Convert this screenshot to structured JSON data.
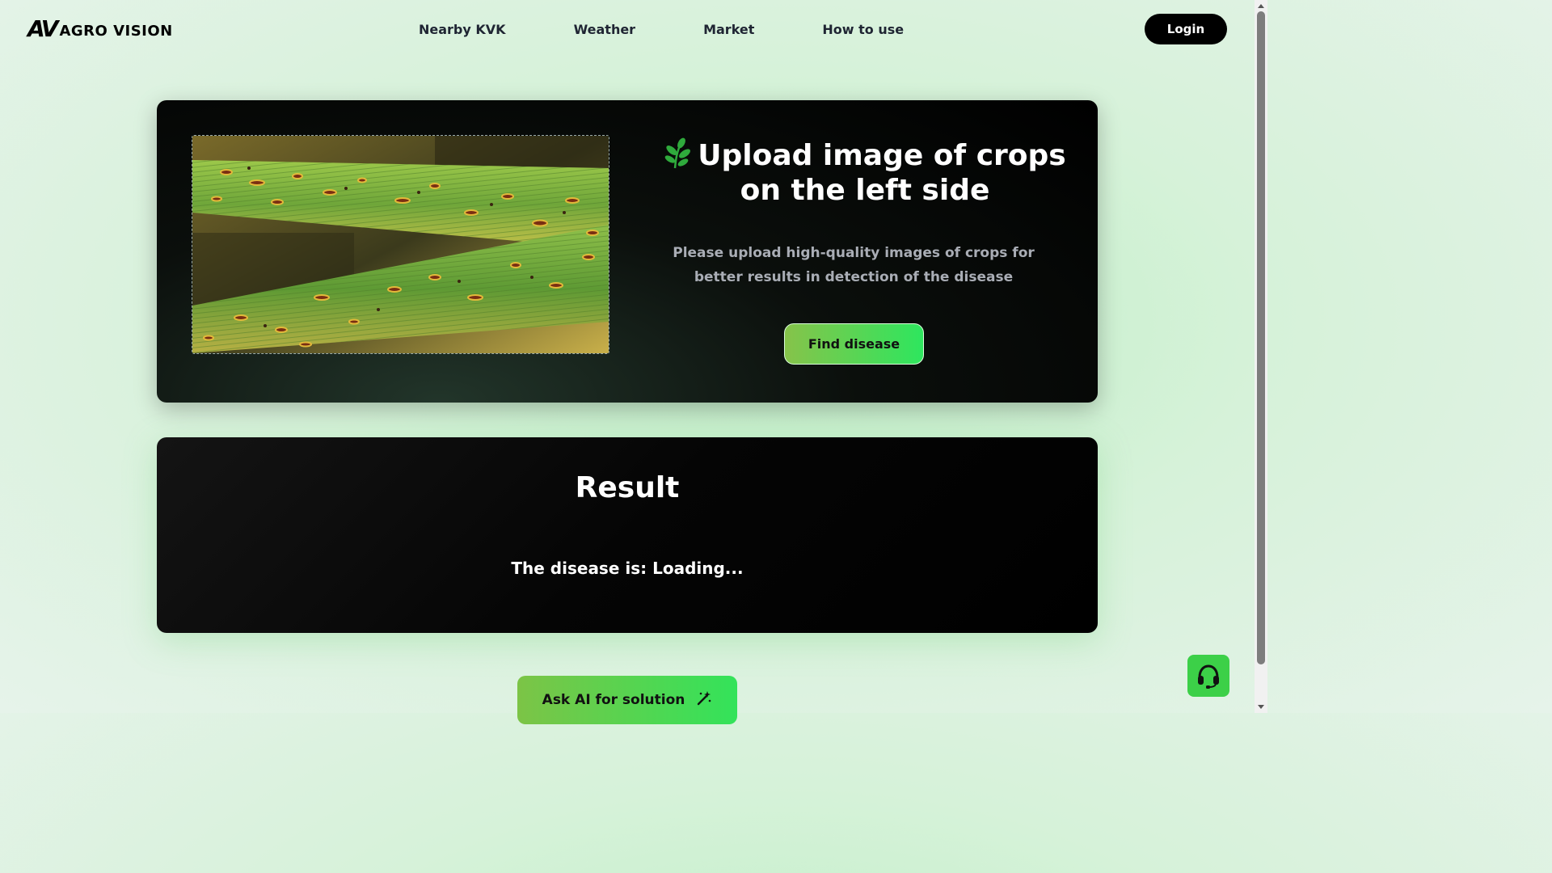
{
  "header": {
    "logo_mark": "AV",
    "logo_text": "AGRO VISION",
    "nav": [
      "Nearby KVK",
      "Weather",
      "Market",
      "How to use"
    ],
    "login_label": "Login"
  },
  "upload": {
    "title_icon": "leaf-icon",
    "title": "Upload image of crops on the left side",
    "description": "Please upload high-quality images of crops for better results in detection of the disease",
    "find_button_label": "Find disease",
    "preview_alt": "crop-leaf-image"
  },
  "result": {
    "title": "Result",
    "text": "The disease is: Loading..."
  },
  "ask_ai": {
    "label": "Ask AI for solution",
    "icon": "magic-wand-icon"
  },
  "support": {
    "icon": "headset-icon"
  },
  "colors": {
    "accent_green": "#2ee65e",
    "button_gradient_start": "#86c34a",
    "support_green": "#3cd048",
    "card_bg": "#000000"
  }
}
